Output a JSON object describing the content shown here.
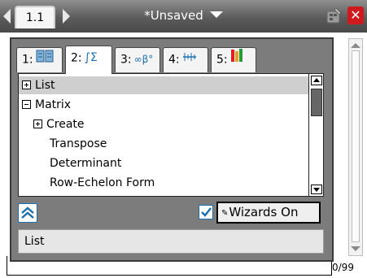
{
  "titlebar": {
    "page_tab": "1.1",
    "document_title": "*Unsaved"
  },
  "catalog": {
    "tabs": [
      {
        "label": "1:",
        "icon": "book-icon"
      },
      {
        "label": "2:",
        "icon": "integral-sum-icon"
      },
      {
        "label": "3:",
        "icon": "infinity-beta-icon"
      },
      {
        "label": "4:",
        "icon": "units-icon"
      },
      {
        "label": "5:",
        "icon": "library-icon"
      }
    ],
    "active_tab": 2,
    "list_items": [
      {
        "label": "List",
        "expander": "plus",
        "indent": 0,
        "selected": true
      },
      {
        "label": "Matrix",
        "expander": "minus",
        "indent": 0,
        "selected": false
      },
      {
        "label": "Create",
        "expander": "plus",
        "indent": 1,
        "selected": false
      },
      {
        "label": "Transpose",
        "expander": "",
        "indent": 2,
        "selected": false
      },
      {
        "label": "Determinant",
        "expander": "",
        "indent": 2,
        "selected": false
      },
      {
        "label": "Row-Echelon Form",
        "expander": "",
        "indent": 2,
        "selected": false
      }
    ],
    "wizards_label": "Wizards On",
    "wizards_checked": true,
    "description": "List"
  },
  "document": {
    "entry_counter": "0/99"
  },
  "colors": {
    "accent_blue": "#1a6fb0",
    "close_red": "#d0191c",
    "panel_gray": "#7c7c7c",
    "selection_gray": "#cfcfcf"
  }
}
